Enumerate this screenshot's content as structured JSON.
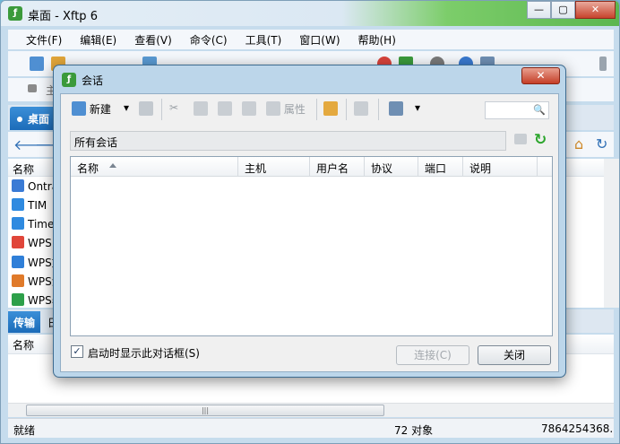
{
  "main_window": {
    "title": "桌面 - Xftp 6",
    "app_icon": "xftp-icon",
    "caption_buttons": [
      "minimize",
      "maximize",
      "close"
    ]
  },
  "menu": [
    "文件(F)",
    "编辑(E)",
    "查看(V)",
    "命令(C)",
    "工具(T)",
    "窗口(W)",
    "帮助(H)"
  ],
  "address": {
    "partial_text": "主"
  },
  "session_tab": {
    "label": "桌面"
  },
  "file_list": {
    "header_name": "名称",
    "items": [
      {
        "label": "Ontra",
        "icon_color": "#3a7bd5"
      },
      {
        "label": "TIM",
        "icon_color": "#2f8ae0"
      },
      {
        "label": "Time(",
        "icon_color": "#2f8ae0"
      },
      {
        "label": "WPS",
        "icon_color": "#e0463a"
      },
      {
        "label": "WPS文",
        "icon_color": "#2f7fd8"
      },
      {
        "label": "WPS演",
        "icon_color": "#e07a2a"
      },
      {
        "label": "WPS表",
        "icon_color": "#2ea04a"
      }
    ]
  },
  "transfer_tabs": {
    "active": "传输",
    "partial": "日"
  },
  "transfer_header": {
    "name": "名称"
  },
  "status": {
    "left": "就绪",
    "count": "72 对象",
    "size": "7864254368."
  },
  "dialog": {
    "title": "会话",
    "close_label": "✕",
    "toolbar": {
      "new_label": "新建",
      "properties_label": "属性"
    },
    "path": "所有会话",
    "columns": [
      "名称",
      "主机",
      "用户名",
      "协议",
      "端口",
      "说明"
    ],
    "show_on_startup_label": "启动时显示此对话框(S)",
    "show_on_startup_checked": true,
    "connect_label": "连接(C)",
    "close_button_label": "关闭"
  },
  "colors": {
    "accent_blue": "#1c6cb9",
    "title_green": "#5bb64f",
    "close_red": "#c53e27"
  }
}
